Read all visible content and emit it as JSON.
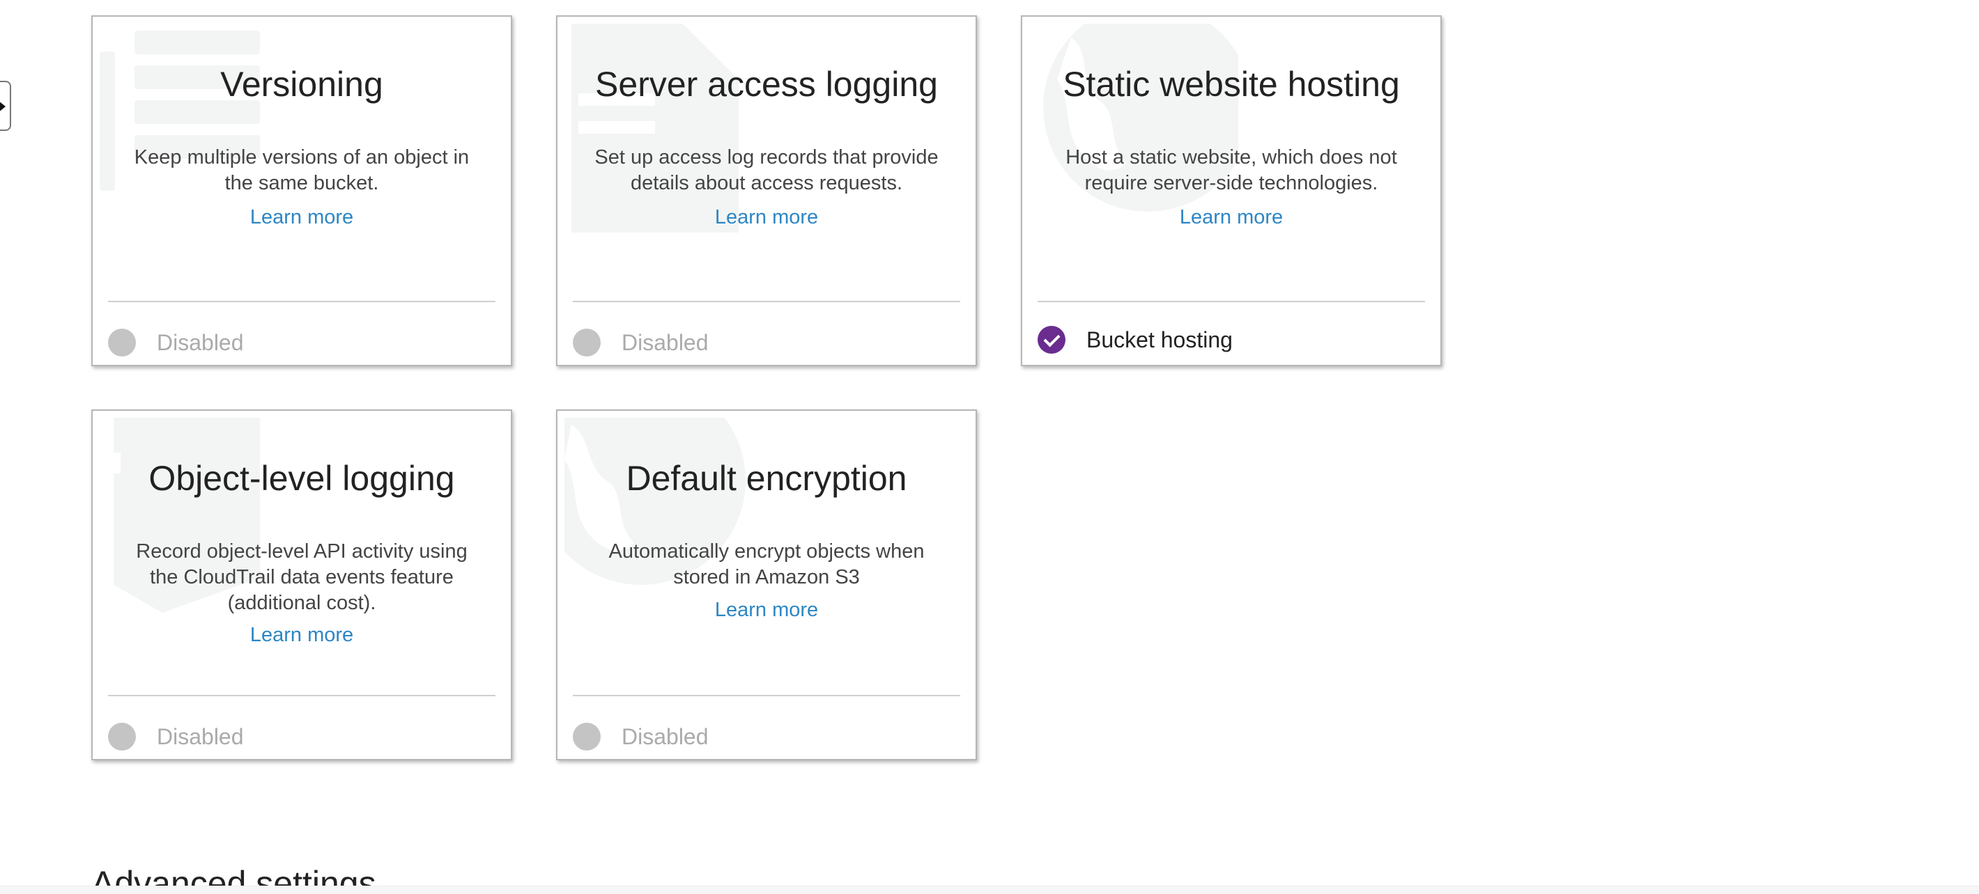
{
  "cards": [
    {
      "title": "Versioning",
      "description": "Keep multiple versions of an object in the same bucket.",
      "learn_more": "Learn more",
      "status": "Disabled",
      "enabled": false,
      "icon": "versioning-icon"
    },
    {
      "title": "Server access logging",
      "description": "Set up access log records that provide details about access requests.",
      "learn_more": "Learn more",
      "status": "Disabled",
      "enabled": false,
      "icon": "access-log-icon"
    },
    {
      "title": "Static website hosting",
      "description": "Host a static website, which does not require server-side technologies.",
      "learn_more": "Learn more",
      "status": "Bucket hosting",
      "enabled": true,
      "icon": "globe-icon"
    },
    {
      "title": "Object-level logging",
      "description": "Record object-level API activity using the CloudTrail data events feature (additional cost).",
      "learn_more": "Learn more",
      "status": "Disabled",
      "enabled": false,
      "icon": "cloudtrail-icon"
    },
    {
      "title": "Default encryption",
      "description": "Automatically encrypt objects when stored in Amazon S3",
      "learn_more": "Learn more",
      "status": "Disabled",
      "enabled": false,
      "icon": "globe-icon"
    }
  ],
  "advanced_settings": {
    "heading": "Advanced settings"
  },
  "colors": {
    "link": "#2d86c4",
    "enabled_dot": "#6b2c8f",
    "disabled_dot": "#c4c4c4"
  }
}
